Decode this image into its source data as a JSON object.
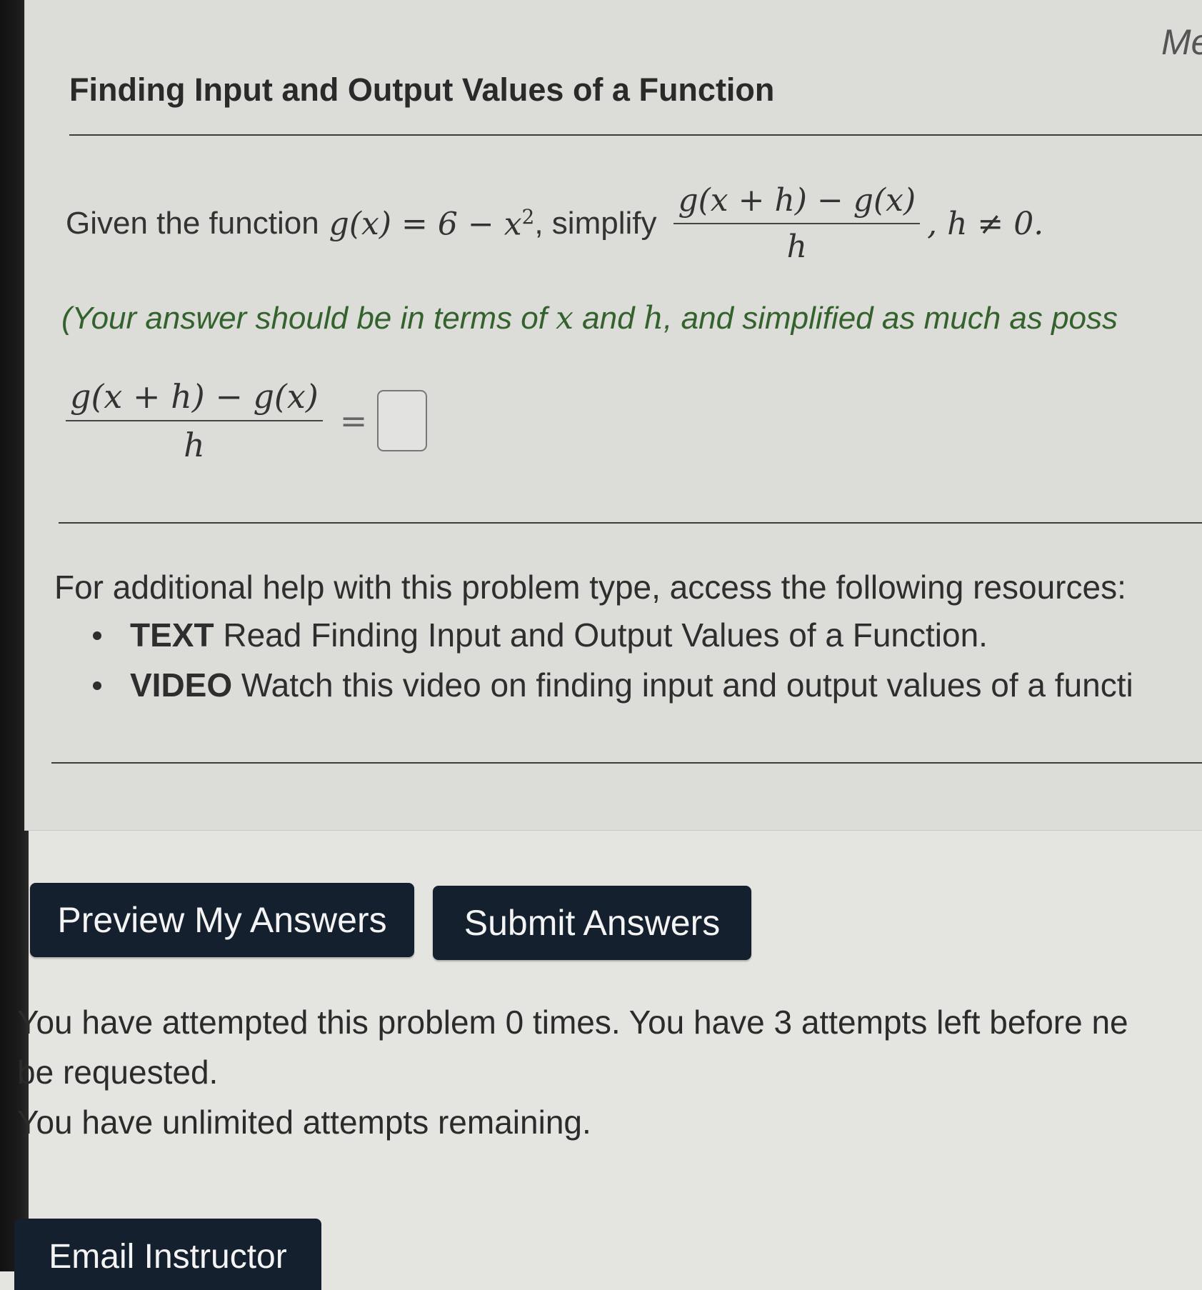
{
  "corner_text": "Me",
  "problem": {
    "title": "Finding Input and Output Values of a Function",
    "question": {
      "prefix": "Given the function",
      "function_lhs": "g(x)",
      "equals": "=",
      "function_rhs_const": "6 − x",
      "function_rhs_exp": "2",
      "mid": ", simplify",
      "frac_numerator": "g(x + h) − g(x)",
      "frac_denominator": "h",
      "suffix": ", h ≠ 0."
    },
    "hint": {
      "p1": "(Your answer should be in terms of ",
      "x": "x",
      "p2": " and ",
      "h": "h",
      "p3": ", and simplified as much as poss"
    },
    "answer": {
      "lhs_numerator": "g(x + h) − g(x)",
      "lhs_denominator": "h",
      "equals": "=",
      "value": ""
    }
  },
  "help": {
    "intro": "For additional help with this problem type, access the following resources:",
    "resources": [
      {
        "type": "TEXT",
        "text": " Read Finding Input and Output Values of a Function."
      },
      {
        "type": "VIDEO",
        "text": " Watch this video on finding input and output values of a functi"
      }
    ]
  },
  "buttons": {
    "preview": "Preview My Answers",
    "submit": "Submit Answers",
    "email": "Email Instructor"
  },
  "attempts": {
    "line1": "You have attempted this problem 0 times. You have 3 attempts left before ne",
    "line2": "be requested.",
    "line3": "You have unlimited attempts remaining."
  }
}
